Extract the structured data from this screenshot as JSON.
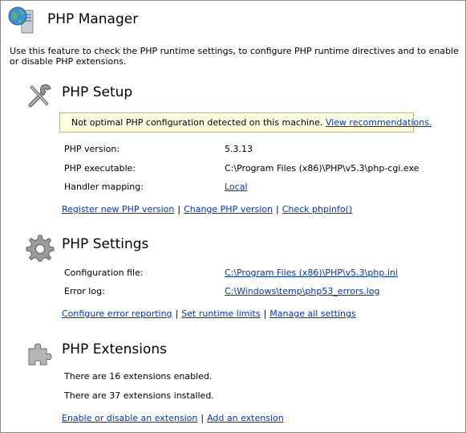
{
  "header": {
    "title": "PHP Manager",
    "icon": "globe-server-icon"
  },
  "description": "Use this feature to check the PHP runtime settings, to configure PHP runtime directives and to enable or disable PHP extensions.",
  "setup": {
    "title": "PHP Setup",
    "icon": "tools-icon",
    "warning": {
      "text": "Not optimal PHP configuration detected on this machine.",
      "link": "View recommendations."
    },
    "rows": [
      {
        "label": "PHP version:",
        "value": "5.3.13"
      },
      {
        "label": "PHP executable:",
        "value": "C:\\Program Files (x86)\\PHP\\v5.3\\php-cgi.exe"
      },
      {
        "label": "Handler mapping:",
        "value": "Local"
      }
    ],
    "links": [
      "Register new PHP version",
      "Change PHP version",
      "Check phpinfo()"
    ]
  },
  "settings": {
    "title": "PHP Settings",
    "icon": "gear-icon",
    "rows": [
      {
        "label": "Configuration file:",
        "value": "C:\\Program Files (x86)\\PHP\\v5.3\\php.ini"
      },
      {
        "label": "Error log:",
        "value": "C:\\Windows\\temp\\php53_errors.log"
      }
    ],
    "links": [
      "Configure error reporting",
      "Set runtime limits",
      "Manage all settings"
    ]
  },
  "extensions": {
    "title": "PHP Extensions",
    "icon": "puzzle-icon",
    "lines": [
      "There are 16 extensions enabled.",
      "There are 37 extensions installed."
    ],
    "links": [
      "Enable or disable an extension",
      "Add an extension"
    ]
  },
  "colors": {
    "link": "#0033cc",
    "warning_bg": "#ffffe1",
    "warning_icon": "#f2c500"
  }
}
